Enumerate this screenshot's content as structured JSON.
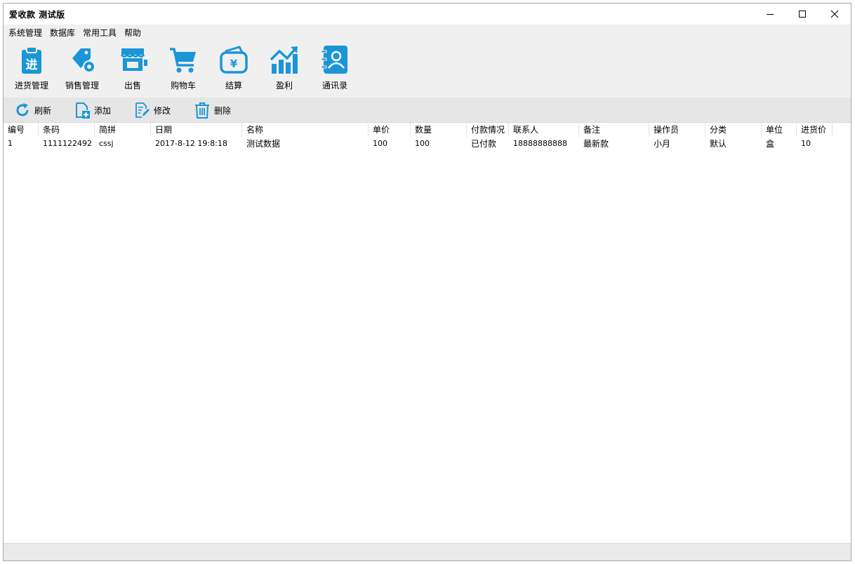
{
  "window": {
    "title": "爱收款 测试版"
  },
  "menu": [
    "系统管理",
    "数据库",
    "常用工具",
    "帮助"
  ],
  "toolbar": {
    "accent": "#1a96d8",
    "items": [
      {
        "label": "进货管理",
        "icon": "clipboard-icon",
        "glyph": "进"
      },
      {
        "label": "销售管理",
        "icon": "tag-gear-icon"
      },
      {
        "label": "出售",
        "icon": "storefront-icon"
      },
      {
        "label": "购物车",
        "icon": "shopping-cart-icon"
      },
      {
        "label": "结算",
        "icon": "wallet-icon",
        "glyph": "¥"
      },
      {
        "label": "盈利",
        "icon": "profit-chart-icon"
      },
      {
        "label": "通讯录",
        "icon": "contacts-book-icon"
      }
    ]
  },
  "actions": [
    {
      "label": "刷新",
      "icon": "refresh-icon"
    },
    {
      "label": "添加",
      "icon": "add-file-icon"
    },
    {
      "label": "修改",
      "icon": "edit-icon"
    },
    {
      "label": "删除",
      "icon": "trash-icon"
    }
  ],
  "table": {
    "columns": [
      "编号",
      "条码",
      "简拼",
      "日期",
      "名称",
      "单价",
      "数量",
      "付款情况",
      "联系人",
      "备注",
      "操作员",
      "分类",
      "单位",
      "进货价"
    ],
    "rows": [
      [
        "1",
        "1111122492",
        "cssj",
        "2017-8-12 19:8:18",
        "测试数据",
        "100",
        "100",
        "已付款",
        "18888888888",
        "最新款",
        "小月",
        "默认",
        "盒",
        "10"
      ]
    ]
  }
}
